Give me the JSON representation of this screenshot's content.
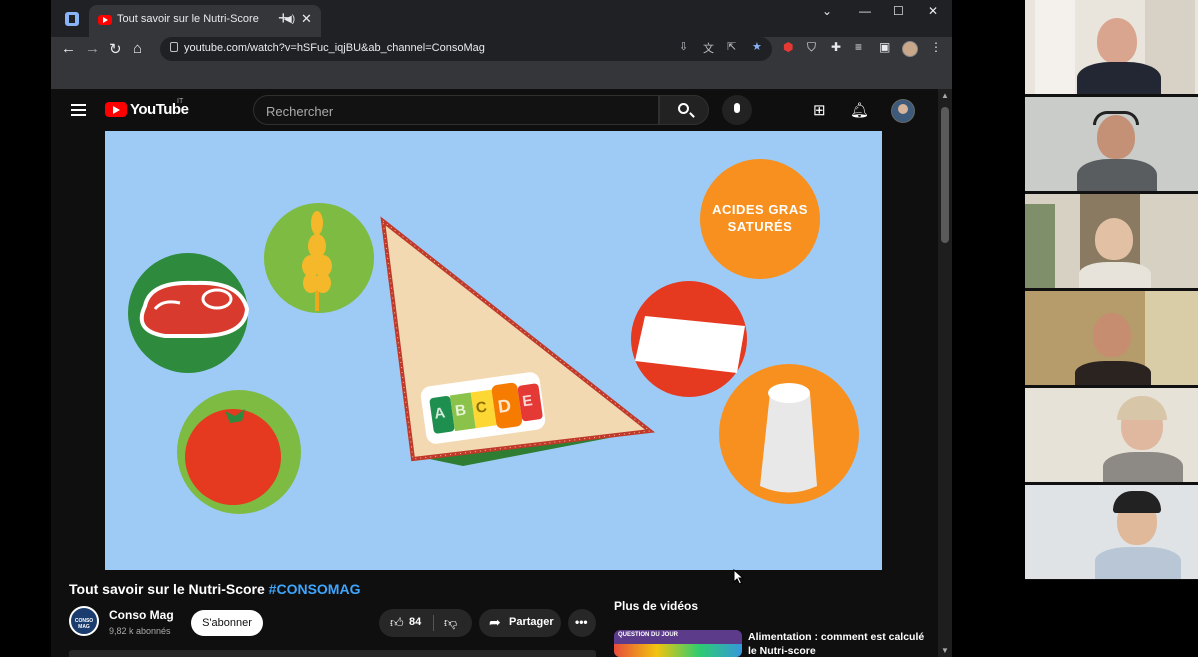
{
  "browser": {
    "tab_title": "Tout savoir sur le Nutri-Score",
    "audio_icon": "speaker-icon",
    "url": "youtube.com/watch?v=hSFuc_iqjBU&ab_channel=ConsoMag"
  },
  "youtube": {
    "logo_text": "YouTube",
    "logo_country": "IT",
    "search_placeholder": "Rechercher",
    "video_title": "Tout savoir sur le Nutri-Score",
    "video_hashtag": "#CONSOMAG",
    "channel": {
      "name": "Conso Mag",
      "subscribers": "9,82 k abonnés",
      "avatar_text": "CONSO MAG"
    },
    "subscribe_label": "S'abonner",
    "like_count": "84",
    "share_label": "Partager",
    "more_videos_label": "Plus de vidéos",
    "recommended": {
      "title": "Alimentation : comment est calculé le Nutri-score",
      "thumb_text": "QUESTION DU JOUR"
    }
  },
  "video_frame": {
    "badge_text": "ACIDES GRAS SATURÉS",
    "nutriscore_letters": [
      "A",
      "B",
      "C",
      "D",
      "E"
    ],
    "nutriscore_colors": [
      "#1e8f4e",
      "#8bc34a",
      "#fdd835",
      "#f57c00",
      "#e53935"
    ],
    "colors": {
      "background": "#9ecbf5",
      "orange": "#f7901e",
      "red": "#e53920",
      "green": "#7dbb42"
    }
  },
  "colors": {
    "chrome_dark": "#202124",
    "chrome_toolbar": "#35363a",
    "yt_bg": "#0f0f0f",
    "link_blue": "#3ea6ff"
  }
}
